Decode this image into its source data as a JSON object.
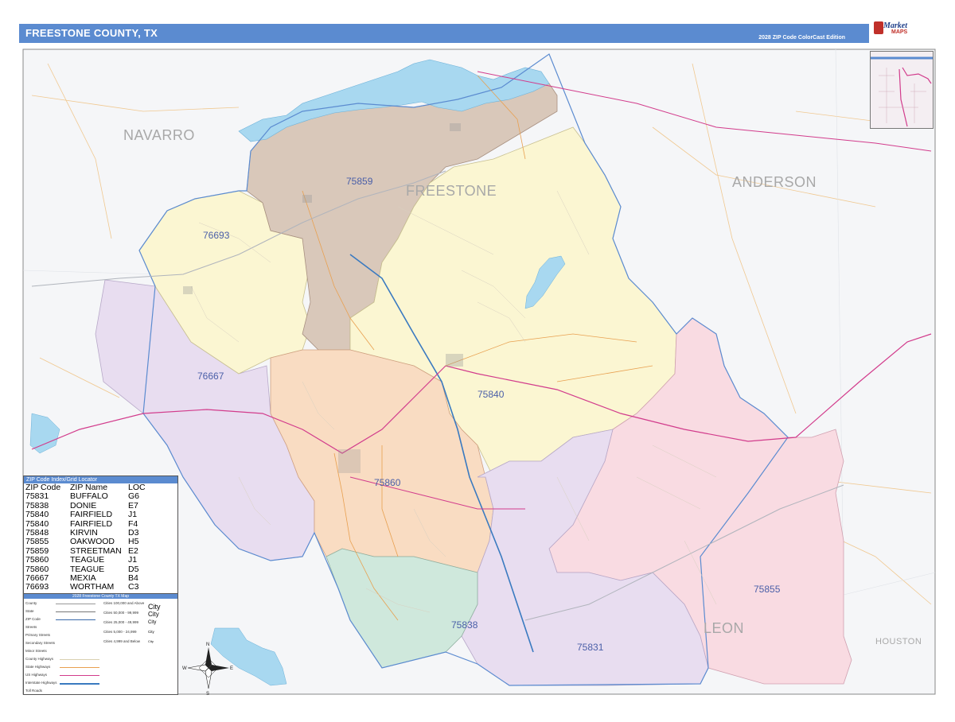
{
  "header": {
    "title": "FREESTONE COUNTY, TX",
    "subtitle": "2028 ZIP Code ColorCast Edition"
  },
  "logo": {
    "name_line1": "Market",
    "name_line2": "MAPS"
  },
  "map": {
    "colors": {
      "water": "#a8d8f0",
      "zip_75859": "#d9c8ba",
      "zip_75840": "#fbf6d2",
      "zip_76693": "#fbf6d2",
      "zip_75860": "#f9dcc2",
      "zip_76667": "#e8ddf0",
      "zip_75855": "#f9dbe2",
      "zip_75831": "#e8ddf0",
      "zip_75838": "#cfe8dc",
      "county_border": "#5b8bd0",
      "highway_us": "#d23c8c",
      "interstate": "#3a7ac0",
      "state_hwy": "#e8a050"
    },
    "county_labels": {
      "navarro": "NAVARRO",
      "anderson": "ANDERSON",
      "freestone": "FREESTONE",
      "leon": "LEON",
      "houston": "HOUSTON"
    },
    "zip_labels": {
      "z75859": "75859",
      "z76693": "76693",
      "z76667": "76667",
      "z75840": "75840",
      "z75860": "75860",
      "z75855": "75855",
      "z75838": "75838",
      "z75831": "75831"
    }
  },
  "zip_index": {
    "title": "ZIP Code Index/Grid Locator",
    "columns": [
      "ZIP Code",
      "ZIP Name",
      "LOC"
    ],
    "rows": [
      [
        "75831",
        "BUFFALO",
        "G6"
      ],
      [
        "75838",
        "DONIE",
        "E7"
      ],
      [
        "75840",
        "FAIRFIELD",
        "J1"
      ],
      [
        "75840",
        "FAIRFIELD",
        "F4"
      ],
      [
        "75848",
        "KIRVIN",
        "D3"
      ],
      [
        "75855",
        "OAKWOOD",
        "H5"
      ],
      [
        "75859",
        "STREETMAN",
        "E2"
      ],
      [
        "75860",
        "TEAGUE",
        "J1"
      ],
      [
        "75860",
        "TEAGUE",
        "D5"
      ],
      [
        "76667",
        "MEXIA",
        "B4"
      ],
      [
        "76693",
        "WORTHAM",
        "C3"
      ]
    ]
  },
  "legend": {
    "title": "2028 Freestone County TX Map",
    "items": [
      "County",
      "State",
      "ZIP Code",
      "Streets",
      "Primary Streets",
      "Secondary Streets",
      "Minor Streets",
      "County Highways",
      "State Highways",
      "US Highways",
      "Interstate Highways",
      "Toll Roads"
    ],
    "city_sizes": [
      "Cities 100,000 and Above",
      "Cities 50,000 - 99,999",
      "Cities 25,000 - 49,999",
      "Cities 5,000 - 24,999",
      "Cities 4,999 and Below"
    ],
    "city_samples": [
      "City",
      "City",
      "City",
      "City",
      "City"
    ],
    "compass": {
      "n": "N",
      "s": "S",
      "e": "E",
      "w": "W"
    }
  }
}
